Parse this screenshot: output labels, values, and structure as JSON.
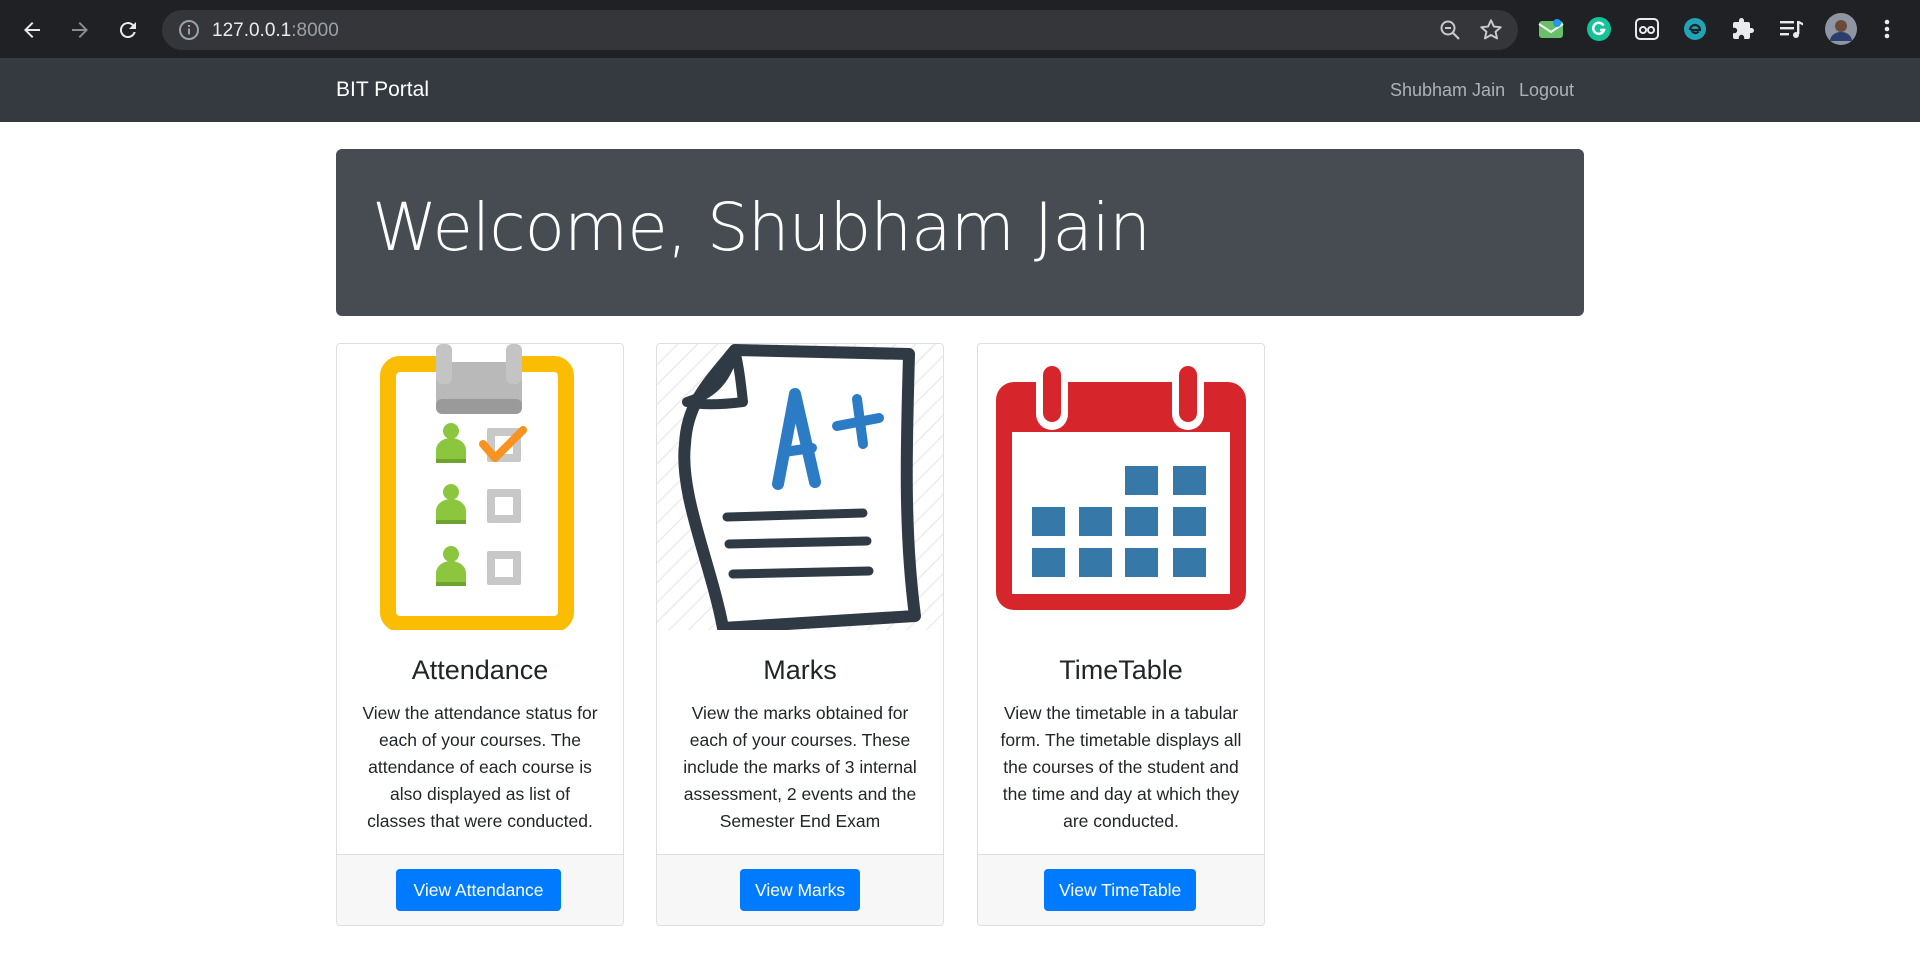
{
  "browser": {
    "url_host": "127.0.0.1",
    "url_port": ":8000",
    "icons": [
      "back-icon",
      "forward-icon",
      "reload-icon",
      "site-info-icon",
      "zoom-icon",
      "bookmark-star-icon",
      "mail-extension-icon",
      "grammarly-extension-icon",
      "reader-extension-icon",
      "edge-extension-icon",
      "extensions-puzzle-icon",
      "media-queue-icon",
      "profile-avatar",
      "menu-kebab-icon"
    ]
  },
  "navbar": {
    "brand": "BIT Portal",
    "user_link": "Shubham Jain",
    "logout_link": "Logout",
    "bg_color": "#343a40"
  },
  "jumbotron": {
    "heading": "Welcome, Shubham Jain"
  },
  "cards": [
    {
      "title": "Attendance",
      "text": "View the attendance status for each of your courses. The attendance of each course is also displayed as list of classes that were conducted.",
      "button": "View Attendance",
      "image": "attendance-clipboard-icon"
    },
    {
      "title": "Marks",
      "text": "View the marks obtained for each of your courses. These include the marks of 3 internal assessment, 2 events and the Semester End Exam",
      "button": "View Marks",
      "image": "marks-paper-icon"
    },
    {
      "title": "TimeTable",
      "text": "View the timetable in a tabular form. The timetable displays all the courses of the student and the time and day at which they are conducted.",
      "button": "View TimeTable",
      "image": "timetable-calendar-icon"
    }
  ],
  "colors": {
    "primary": "#007bff",
    "jumbotron": "#474c53",
    "clipboard": "#fbbc04",
    "calendar": "#d7262b",
    "calendar_cells": "#3679a9",
    "person": "#8cc63f",
    "check": "#f7931e"
  }
}
